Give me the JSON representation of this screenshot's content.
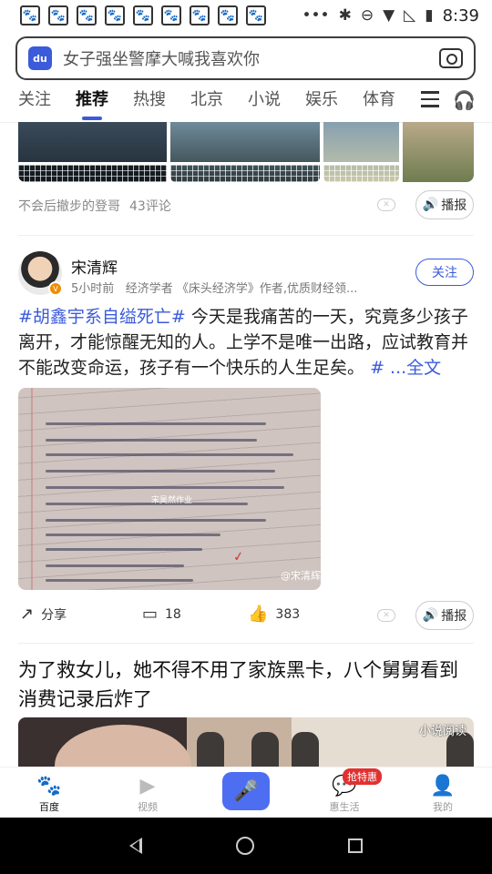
{
  "status": {
    "time": "8:39",
    "notification_icon_count": 9
  },
  "search": {
    "placeholder": "女子强坐警摩大喊我喜欢你",
    "logo_text": "du"
  },
  "tabs": [
    {
      "label": "关注",
      "active": false
    },
    {
      "label": "推荐",
      "active": true
    },
    {
      "label": "热搜",
      "active": false
    },
    {
      "label": "北京",
      "active": false
    },
    {
      "label": "小说",
      "active": false
    },
    {
      "label": "娱乐",
      "active": false
    },
    {
      "label": "体育",
      "active": false
    }
  ],
  "card1": {
    "source": "不会后撤步的登哥",
    "comments": "43评论",
    "play_label": "播报"
  },
  "post": {
    "author": "宋清辉",
    "time": "5小时前",
    "bio": "经济学者 《床头经济学》作者,优质财经领...",
    "follow_label": "关注",
    "hashtag": "#胡鑫宇系自缢死亡#",
    "body": " 今天是我痛苦的一天，究竟多少孩子离开，才能惊醒无知的人。上学不是唯一出路，应试教育并不能改变命运，孩子有一个快乐的人生足矣。",
    "hash_more": "#",
    "full_text_link": " ...全文",
    "image_watermark": "宋昊然作业",
    "image_credit": "@宋清辉",
    "share_label": "分享",
    "comment_count": "18",
    "like_count": "383",
    "play_label": "播报"
  },
  "article": {
    "headline": "为了救女儿，她不得不用了家族黑卡，八个舅舅看到消费记录后炸了",
    "thumb_label": "小说阅读"
  },
  "bottom_nav": [
    {
      "label": "百度",
      "icon": "baidu-paw-icon",
      "active": true
    },
    {
      "label": "视频",
      "icon": "video-play-icon",
      "active": false
    },
    {
      "label": "",
      "icon": "microphone-icon",
      "active": false
    },
    {
      "label": "惠生活",
      "icon": "chat-bubble-icon",
      "active": false,
      "badge": "抢特惠"
    },
    {
      "label": "我的",
      "icon": "person-icon",
      "active": false
    }
  ],
  "colors": {
    "accent": "#3b5bdb",
    "mic": "#4e6ef2",
    "badge": "#e03131"
  }
}
